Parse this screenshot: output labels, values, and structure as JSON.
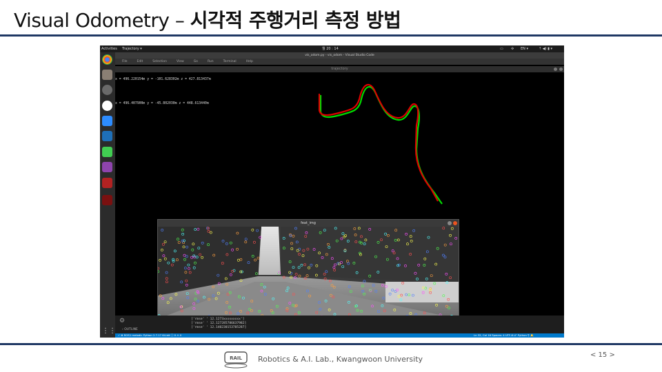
{
  "slide": {
    "title_en": "Visual Odometry – ",
    "title_ko": "시각적 주행거리 측정 방법",
    "footer": "Robotics & A.I. Lab., Kwangwoon University",
    "logo_text": "RAIL",
    "page": "< 15 >"
  },
  "colors": {
    "rule": "#1f3864",
    "gt_path": "#00dd00",
    "est_path": "#dd0000",
    "statusbar": "#007acc"
  },
  "desktop": {
    "activities": "Activities",
    "app_menu": "Trajectory ▾",
    "clock": "월 20 : 14",
    "tray": [
      "EN ▾"
    ],
    "dock_icons": [
      "chrome-icon",
      "files-icon",
      "settings-icon",
      "slack-icon",
      "zoom-icon",
      "vscode-icon",
      "qt-icon",
      "image-viewer-icon",
      "terminal-icon",
      "terminal2-icon",
      "apps-grid-icon"
    ]
  },
  "vscode": {
    "window_title": "vis_odom.py - vis_odom - Visual Studio Code",
    "menu": [
      "File",
      "Edit",
      "Selection",
      "View",
      "Go",
      "Run",
      "Terminal",
      "Help"
    ],
    "outline_label": "› OUTLINE",
    "terminal_lines": [
      "['rmse'     ' 12.1273xxxxxxxxx']",
      "['rmse'     '  12.127285786637982]",
      "['rmse'     '  12.140230153705287]"
    ],
    "status": {
      "left": "✓  ⊗ ROS1 melodic   Python 2.7.17 64-bit   ⓘ 0 ⚠ 0",
      "right": "Ln 32, Col 16   Spaces: 4   UTF-8   LF   Python   ⚲   🔔"
    }
  },
  "trajectory": {
    "window_title": "trajectory",
    "coord_line1": "x = 496.220154m  y = -101.628302m  z = 427.813437m",
    "coord_line2": "x = 496.407900m  y = -45.802030m  z = 448.613440m"
  },
  "feat": {
    "window_title": "feat_img"
  }
}
